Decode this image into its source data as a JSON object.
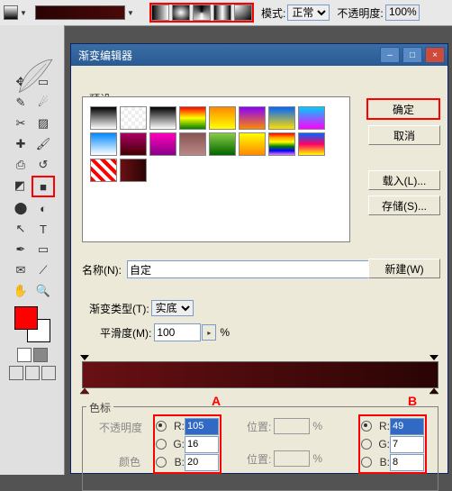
{
  "toolbar": {
    "mode_label": "模式:",
    "mode_value": "正常",
    "opacity_label": "不透明度:",
    "opacity_value": "100%"
  },
  "dialog": {
    "title": "渐变编辑器",
    "presets_label": "预设",
    "buttons": {
      "ok": "确定",
      "cancel": "取消",
      "load": "载入(L)...",
      "save": "存储(S)..."
    },
    "name_label": "名称(N):",
    "name_value": "自定",
    "new_btn": "新建(W)",
    "type_label": "渐变类型(T):",
    "type_value": "实底",
    "smooth_label": "平滑度(M):",
    "smooth_value": "100",
    "percent": "%",
    "marker_a": "A",
    "marker_b": "B",
    "colorstop": {
      "title": "色标",
      "opacity_label": "不透明度",
      "color_label": "颜色",
      "pos_label": "位置:",
      "R": "R:",
      "G": "G:",
      "B": "B:",
      "A": {
        "r": "105",
        "g": "16",
        "b": "20"
      },
      "Bv": {
        "r": "49",
        "g": "7",
        "b": "8"
      }
    }
  }
}
